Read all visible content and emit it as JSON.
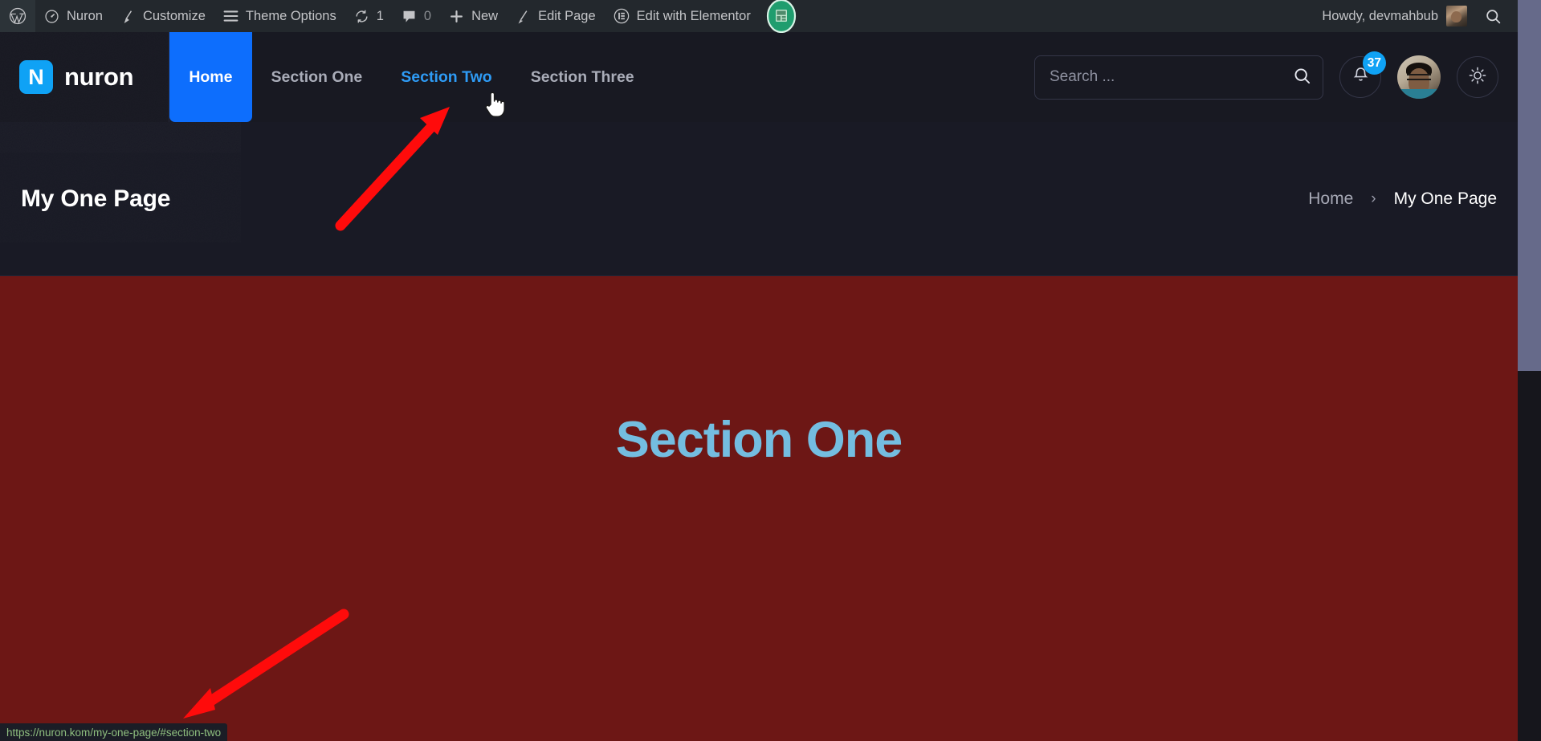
{
  "adminbar": {
    "wp_logo": "wordpress-logo-icon",
    "items": [
      {
        "icon": "dashboard-icon",
        "label": "Nuron"
      },
      {
        "icon": "brush-icon",
        "label": "Customize"
      },
      {
        "icon": "hamburger-icon",
        "label": "Theme Options"
      },
      {
        "icon": "updates-icon",
        "label": "1"
      },
      {
        "icon": "comment-icon",
        "label": "0"
      },
      {
        "icon": "plus-icon",
        "label": "New"
      },
      {
        "icon": "pencil-icon",
        "label": "Edit Page"
      },
      {
        "icon": "elementor-icon",
        "label": "Edit with Elementor"
      }
    ],
    "elementor_badge": "elementor-green-badge-icon",
    "howdy": "Howdy, devmahbub",
    "search_icon": "search-icon"
  },
  "header": {
    "brand": {
      "mark": "N",
      "name": "nuron"
    },
    "nav": [
      {
        "label": "Home",
        "state": "active"
      },
      {
        "label": "Section One",
        "state": "default"
      },
      {
        "label": "Section Two",
        "state": "hover"
      },
      {
        "label": "Section Three",
        "state": "default"
      }
    ],
    "search": {
      "placeholder": "Search ...",
      "value": "",
      "icon": "search-icon"
    },
    "notifications": {
      "icon": "bell-icon",
      "count": "37"
    },
    "avatar": "user-avatar",
    "theme_toggle": "sun-icon"
  },
  "title_band": {
    "page_title": "My One Page",
    "breadcrumb": {
      "home": "Home",
      "separator": "›",
      "current": "My One Page"
    }
  },
  "main": {
    "section_heading": "Section One"
  },
  "status_bar": {
    "url": "https://nuron.kom/my-one-page/#section-two"
  },
  "colors": {
    "admin_bar_bg": "#23282d",
    "header_bg": "#181922",
    "title_band_bg": "#191a25",
    "section_bg": "#6d1715",
    "accent_blue": "#0d6efd",
    "brand_blue": "#0fa2f5",
    "hover_blue": "#2e9bf5",
    "heading_blue": "#74bde0",
    "annotation_red": "#ff0b0b",
    "status_url_text": "#8fbf7f",
    "scrollbar_thumb": "#666a8a"
  }
}
